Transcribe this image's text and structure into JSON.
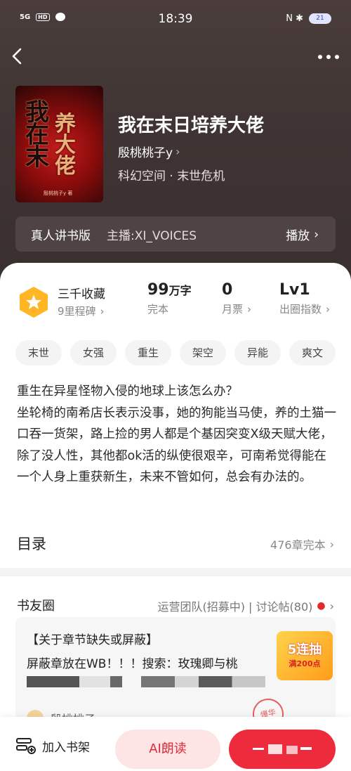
{
  "status_bar": {
    "network": "5G",
    "hd": "HD",
    "time": "18:39",
    "right_icons": "N ✱",
    "battery": "21"
  },
  "book": {
    "title": "我在末日培养大佬",
    "author": "殷桃桃子y",
    "genre": "科幻空间 · 末世危机",
    "cover_title_1": "我在末",
    "cover_title_2": "养大佬",
    "cover_author": "殷桃桃子y 著"
  },
  "audio": {
    "title": "真人讲书版",
    "host": "主播:XI_VOICES",
    "play": "播放"
  },
  "stats": {
    "award_name": "三千收藏",
    "award_sub": "9里程碑",
    "words_value": "99",
    "words_unit": "万字",
    "words_label": "完本",
    "ticket_value": "0",
    "ticket_label": "月票",
    "level_value": "Lv1",
    "level_label": "出圈指数"
  },
  "tags": [
    "末世",
    "女强",
    "重生",
    "架空",
    "异能",
    "爽文"
  ],
  "description": "重生在异星怪物入侵的地球上该怎么办？\n坐轮椅的南希店长表示没事，她的狗能当马使，养的土猫一口吞一货架，路上捡的男人都是个基因突变X级天赋大佬，除了没人性，其他都ok活的纵使很艰辛，可南希觉得能在一个人身上重获新生，未来不管如何，总会有办法的。",
  "toc": {
    "title": "目录",
    "info": "476章完本"
  },
  "circle": {
    "title": "书友圈",
    "links": "运营团队(招募中) | 讨论帖(80)",
    "post_title": "【关于章节缺失或屏蔽】",
    "post_body": "屏蔽章放在WB！！！搜索：玫瑰卿与桃",
    "post_author": "殷桃桃子y",
    "promo_top": "5连抽",
    "promo_bottom": "满200点",
    "stamp": "爆华"
  },
  "bottom": {
    "shelf": "加入书架",
    "ai": "AI朗读"
  },
  "colors": {
    "accent": "#ee2b3d",
    "hero_bg": "#3f3433"
  }
}
